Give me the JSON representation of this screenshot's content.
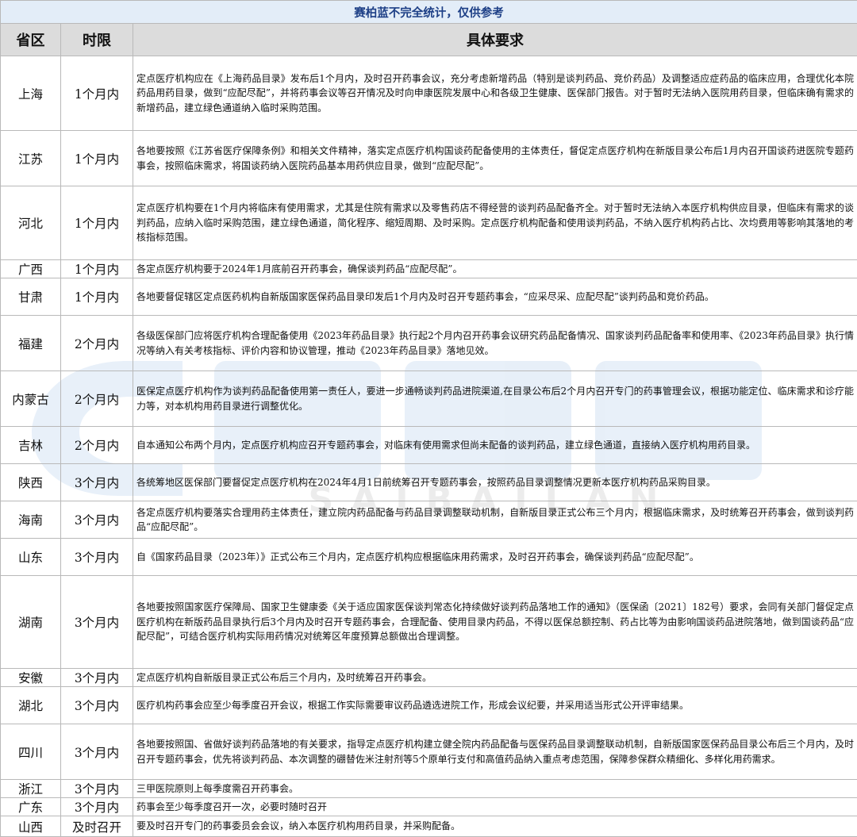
{
  "header_note": "赛柏蓝不完全统计，仅供参考",
  "columns": {
    "province": "省区",
    "term": "时限",
    "requirement": "具体要求"
  },
  "watermark_text": "SAIBAILAN",
  "rows": [
    {
      "province": "上海",
      "term": "1个月内",
      "requirement": "定点医疗机构应在《上海药品目录》发布后1个月内，及时召开药事会议，充分考虑新增药品（特别是谈判药品、竞价药品）及调整适应症药品的临床应用，合理优化本院药品用药目录，做到“应配尽配”，并将药事会议等召开情况及时向申康医院发展中心和各级卫生健康、医保部门报告。对于暂时无法纳入医院用药目录，但临床确有需求的新增药品，建立绿色通道纳入临时采购范围。"
    },
    {
      "province": "江苏",
      "term": "1个月内",
      "requirement": "各地要按照《江苏省医疗保障条例》和相关文件精神，落实定点医疗机构国谈药配备使用的主体责任，督促定点医疗机构在新版目录公布后1月内召开国谈药进医院专题药事会，按照临床需求，将国谈药纳入医院药品基本用药供应目录，做到“应配尽配”。"
    },
    {
      "province": "河北",
      "term": "1个月内",
      "requirement": "定点医疗机构要在1个月内将临床有使用需求，尤其是住院有需求以及零售药店不得经营的谈判药品配备齐全。对于暂时无法纳入本医疗机构供应目录，但临床有需求的谈判药品，应纳入临时采购范围，建立绿色通道，简化程序、缩短周期、及时采购。定点医疗机构配备和使用谈判药品，不纳入医疗机构药占比、次均费用等影响其落地的考核指标范围。"
    },
    {
      "province": "广西",
      "term": "1个月内",
      "requirement": "各定点医疗机构要于2024年1月底前召开药事会，确保谈判药品“应配尽配”。"
    },
    {
      "province": "甘肃",
      "term": "1个月内",
      "requirement": "各地要督促辖区定点医药机构自新版国家医保药品目录印发后1个月内及时召开专题药事会，“应采尽采、应配尽配”谈判药品和竞价药品。"
    },
    {
      "province": "福建",
      "term": "2个月内",
      "requirement": "各级医保部门应将医疗机构合理配备使用《2023年药品目录》执行起2个月内召开药事会议研究药品配备情况、国家谈判药品配备率和使用率、《2023年药品目录》执行情况等纳入有关考核指标、评价内容和协议管理，推动《2023年药品目录》落地见效。"
    },
    {
      "province": "内蒙古",
      "term": "2个月内",
      "requirement": "医保定点医疗机构作为谈判药品配备使用第一责任人，要进一步通畅谈判药品进院渠道,在目录公布后2个月内召开专门的药事管理会议，根据功能定位、临床需求和诊疗能力等，对本机构用药目录进行调整优化。"
    },
    {
      "province": "吉林",
      "term": "2个月内",
      "requirement": "自本通知公布两个月内，定点医疗机构应召开专题药事会，对临床有使用需求但尚未配备的谈判药品，建立绿色通道，直接纳入医疗机构用药目录。"
    },
    {
      "province": "陕西",
      "term": "3个月内",
      "requirement": "各统筹地区医保部门要督促定点医疗机构在2024年4月1日前统筹召开专题药事会，按照药品目录调整情况更新本医疗机构药品采购目录。"
    },
    {
      "province": "海南",
      "term": "3个月内",
      "requirement": "各定点医疗机构要落实合理用药主体责任，建立院内药品配备与药品目录调整联动机制，自新版目录正式公布三个月内，根据临床需求，及时统筹召开药事会，做到谈判药品“应配尽配”。"
    },
    {
      "province": "山东",
      "term": "3个月内",
      "requirement": "自《国家药品目录（2023年）》正式公布三个月内，定点医疗机构应根据临床用药需求，及时召开药事会，确保谈判药品“应配尽配”。"
    },
    {
      "province": "湖南",
      "term": "3个月内",
      "requirement": "各地要按照国家医疗保障局、国家卫生健康委《关于适应国家医保谈判常态化持续做好谈判药品落地工作的通知》（医保函〔2021〕182号）要求，会同有关部门督促定点医疗机构在新版药品目录执行后3个月内及时召开专题药事会，合理配备、使用目录内药品，不得以医保总额控制、药占比等为由影响国谈药品进院落地，做到国谈药品“应配尽配”，可结合医疗机构实际用药情况对统筹区年度预算总额做出合理调整。"
    },
    {
      "province": "安徽",
      "term": "3个月内",
      "requirement": "定点医疗机构自新版目录正式公布后三个月内，及时统筹召开药事会。"
    },
    {
      "province": "湖北",
      "term": "3个月内",
      "requirement": "医疗机构药事会应至少每季度召开会议，根据工作实际需要审议药品遴选进院工作，形成会议纪要，并采用适当形式公开评审结果。"
    },
    {
      "province": "四川",
      "term": "3个月内",
      "requirement": "各地要按照国、省做好谈判药品落地的有关要求，指导定点医疗机构建立健全院内药品配备与医保药品目录调整联动机制，自新版国家医保药品目录公布后三个月内，及时召开专题药事会，优先将谈判药品、本次调整的硼替佐米注射剂等5个原单行支付和高值药品纳入重点考虑范围，保障参保群众精细化、多样化用药需求。"
    },
    {
      "province": "浙江",
      "term": "3个月内",
      "requirement": "三甲医院原则上每季度需召开药事会。"
    },
    {
      "province": "广东",
      "term": "3个月内",
      "requirement": "药事会至少每季度召开一次，必要时随时召开"
    },
    {
      "province": "山西",
      "term": "及时召开",
      "requirement": "要及时召开专门的药事委员会会议，纳入本医疗机构用药目录，并采购配备。"
    }
  ]
}
